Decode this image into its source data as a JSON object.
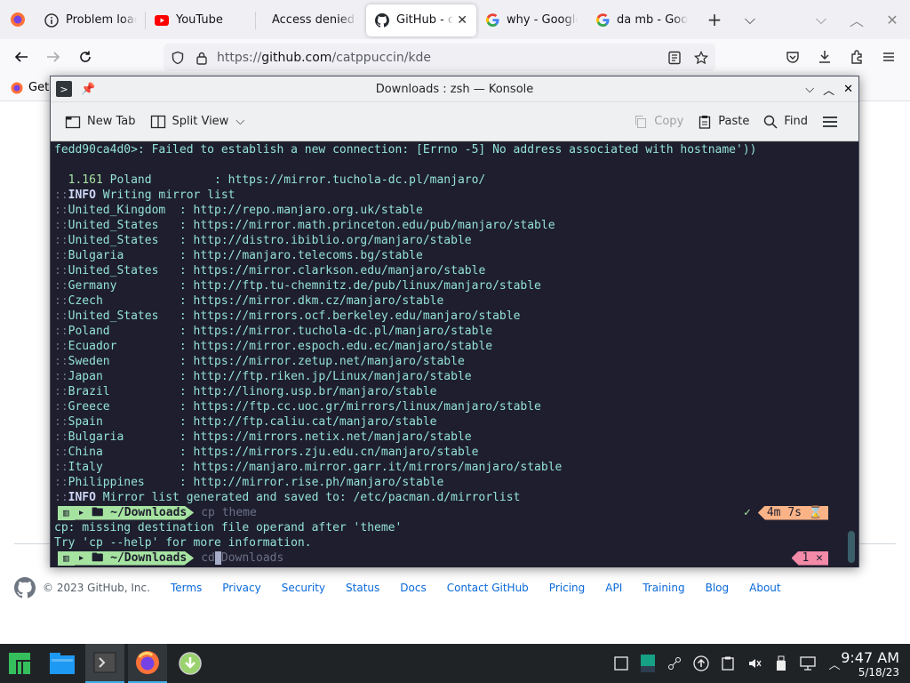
{
  "browser": {
    "tabs": [
      {
        "label": "Problem load",
        "icon": "info-icon",
        "closable": false
      },
      {
        "label": "YouTube",
        "icon": "youtube-icon",
        "closable": false
      },
      {
        "label": "Access denied |",
        "icon": "none",
        "closable": false
      },
      {
        "label": "GitHub - ca",
        "icon": "github-icon",
        "closable": true,
        "active": true
      },
      {
        "label": "why - Google",
        "icon": "google-icon",
        "closable": false
      },
      {
        "label": "da mb - Goog",
        "icon": "google-icon",
        "closable": false
      }
    ],
    "url_prefix": "https://",
    "url_host": "github.com",
    "url_path": "/catppuccin/kde",
    "bookmark_label": "Get"
  },
  "github_footer": {
    "copyright": "© 2023 GitHub, Inc.",
    "links": [
      "Terms",
      "Privacy",
      "Security",
      "Status",
      "Docs",
      "Contact GitHub",
      "Pricing",
      "API",
      "Training",
      "Blog",
      "About"
    ]
  },
  "konsole": {
    "title": "Downloads : zsh — Konsole",
    "toolbar": {
      "new_tab": "New Tab",
      "split_view": "Split View",
      "copy": "Copy",
      "paste": "Paste",
      "find": "Find"
    },
    "lines": {
      "err_conn": "fedd90ca4d0>: Failed to establish a new connection: [Errno -5] No address associated with hostname'))",
      "poland_rate": "  1.161",
      "poland_country": " Poland         : https://mirror.tuchola-dc.pl/manjaro/",
      "info1_tag": "INFO",
      "info1_text": " Writing mirror list",
      "info2_tag": "INFO",
      "info2_text": " Mirror list generated and saved to: /etc/pacman.d/mirrorlist",
      "cp_error": "cp: missing destination file operand after 'theme'",
      "cp_help": "Try 'cp --help' for more information."
    },
    "mirrors": [
      {
        "country": "United_Kingdom ",
        "url": "http://repo.manjaro.org.uk/stable"
      },
      {
        "country": "United_States  ",
        "url": "https://mirror.math.princeton.edu/pub/manjaro/stable"
      },
      {
        "country": "United_States  ",
        "url": "http://distro.ibiblio.org/manjaro/stable"
      },
      {
        "country": "Bulgaria       ",
        "url": "http://manjaro.telecoms.bg/stable"
      },
      {
        "country": "United_States  ",
        "url": "https://mirror.clarkson.edu/manjaro/stable"
      },
      {
        "country": "Germany        ",
        "url": "http://ftp.tu-chemnitz.de/pub/linux/manjaro/stable"
      },
      {
        "country": "Czech          ",
        "url": "https://mirror.dkm.cz/manjaro/stable"
      },
      {
        "country": "United_States  ",
        "url": "https://mirrors.ocf.berkeley.edu/manjaro/stable"
      },
      {
        "country": "Poland         ",
        "url": "https://mirror.tuchola-dc.pl/manjaro/stable"
      },
      {
        "country": "Ecuador        ",
        "url": "https://mirror.espoch.edu.ec/manjaro/stable"
      },
      {
        "country": "Sweden         ",
        "url": "https://mirror.zetup.net/manjaro/stable"
      },
      {
        "country": "Japan          ",
        "url": "http://ftp.riken.jp/Linux/manjaro/stable"
      },
      {
        "country": "Brazil         ",
        "url": "http://linorg.usp.br/manjaro/stable"
      },
      {
        "country": "Greece         ",
        "url": "https://ftp.cc.uoc.gr/mirrors/linux/manjaro/stable"
      },
      {
        "country": "Spain          ",
        "url": "http://ftp.caliu.cat/manjaro/stable"
      },
      {
        "country": "Bulgaria       ",
        "url": "https://mirrors.netix.net/manjaro/stable"
      },
      {
        "country": "China          ",
        "url": "https://mirrors.zju.edu.cn/manjaro/stable"
      },
      {
        "country": "Italy          ",
        "url": "https://manjaro.mirror.garr.it/mirrors/manjaro/stable"
      },
      {
        "country": "Philippines    ",
        "url": "http://mirror.rise.ph/manjaro/stable"
      }
    ],
    "prompt1": {
      "dir": "~/Downloads",
      "command": "cp theme",
      "check": "✓",
      "duration": "4m 7s",
      "hourglass": "⌛"
    },
    "prompt2": {
      "dir": "~/Downloads",
      "typed": "cd",
      "suggestion": "Downloads",
      "exit_code": "1",
      "x": "✕"
    }
  },
  "taskbar": {
    "time": "9:47 AM",
    "date": "5/18/23"
  },
  "colors": {
    "prompt_green": "#a6e3a1",
    "teal": "#94e2d5",
    "orange": "#fab387",
    "red": "#f38ba8",
    "term_bg": "#1e1e2e"
  }
}
